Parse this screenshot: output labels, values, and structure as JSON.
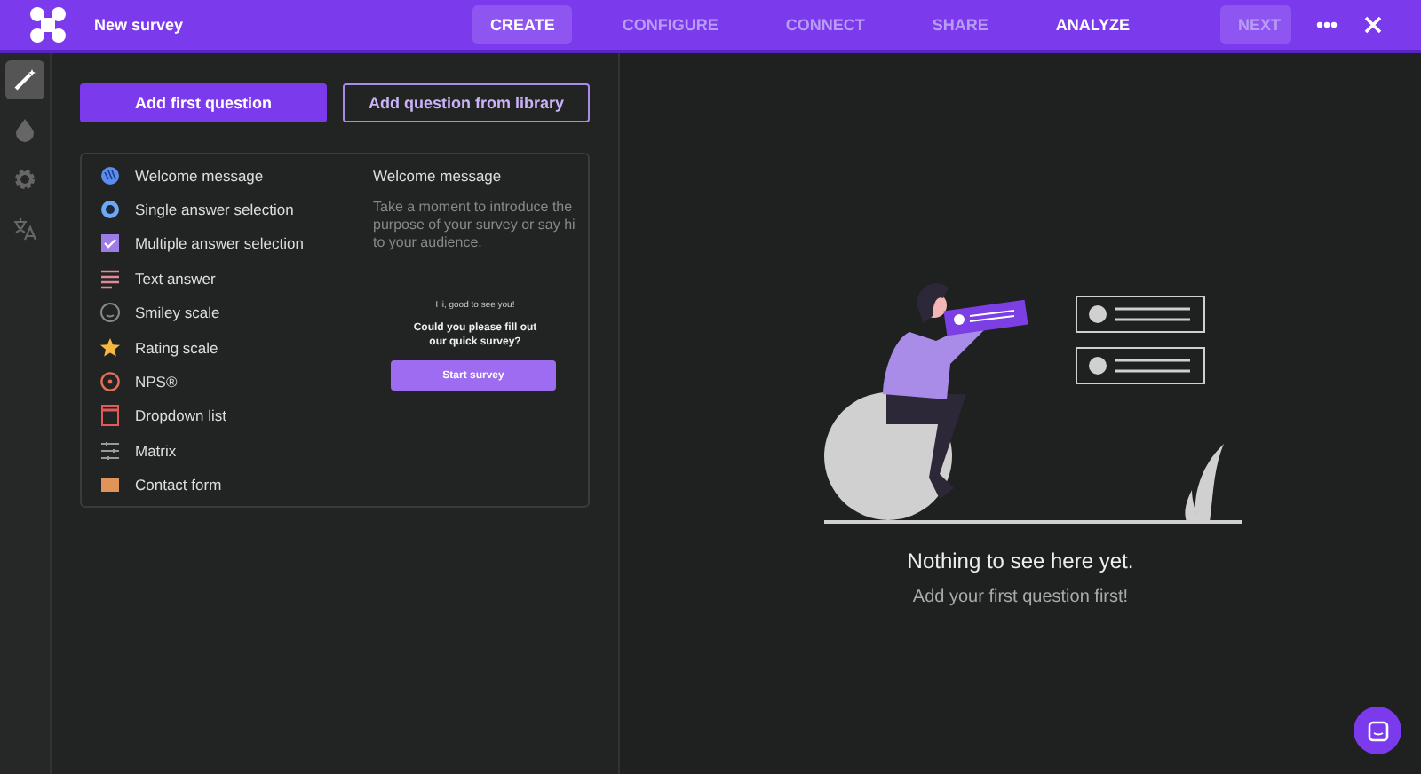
{
  "window": {
    "title": "New survey"
  },
  "tabs": [
    {
      "label": "CREATE",
      "selected": true,
      "disabled": false
    },
    {
      "label": "CONFIGURE",
      "selected": false,
      "disabled": true
    },
    {
      "label": "CONNECT",
      "selected": false,
      "disabled": true
    },
    {
      "label": "SHARE",
      "selected": false,
      "disabled": true
    },
    {
      "label": "ANALYZE",
      "selected": false,
      "disabled": false
    }
  ],
  "next_button": {
    "label": "NEXT",
    "disabled": true
  },
  "sidebar": {
    "items": [
      {
        "kind": "wand",
        "selected": true
      },
      {
        "kind": "drop",
        "selected": false
      },
      {
        "kind": "gear",
        "selected": false
      },
      {
        "kind": "translate",
        "selected": false
      }
    ]
  },
  "buttons": {
    "primary": "Add first question",
    "secondary": "Add question from library"
  },
  "question_types": [
    {
      "kind": "welcome",
      "label": "Welcome message"
    },
    {
      "kind": "single",
      "label": "Single answer selection"
    },
    {
      "kind": "multiple",
      "label": "Multiple answer selection"
    },
    {
      "kind": "text",
      "label": "Text answer"
    },
    {
      "kind": "smiley",
      "label": "Smiley scale"
    },
    {
      "kind": "rating",
      "label": "Rating scale"
    },
    {
      "kind": "nps",
      "label": "NPS®"
    },
    {
      "kind": "dropdown",
      "label": "Dropdown list"
    },
    {
      "kind": "matrix",
      "label": "Matrix"
    },
    {
      "kind": "contact",
      "label": "Contact form"
    }
  ],
  "preview": {
    "title": "Welcome message",
    "description": "Take a moment to introduce the purpose of your survey or say hi to your audience.",
    "greeting": "Hi, good to see you!",
    "question": "Could you please fill out our quick survey?",
    "button": "Start survey"
  },
  "empty_state": {
    "title": "Nothing to see here yet.",
    "subtitle": "Add your first question first!"
  }
}
